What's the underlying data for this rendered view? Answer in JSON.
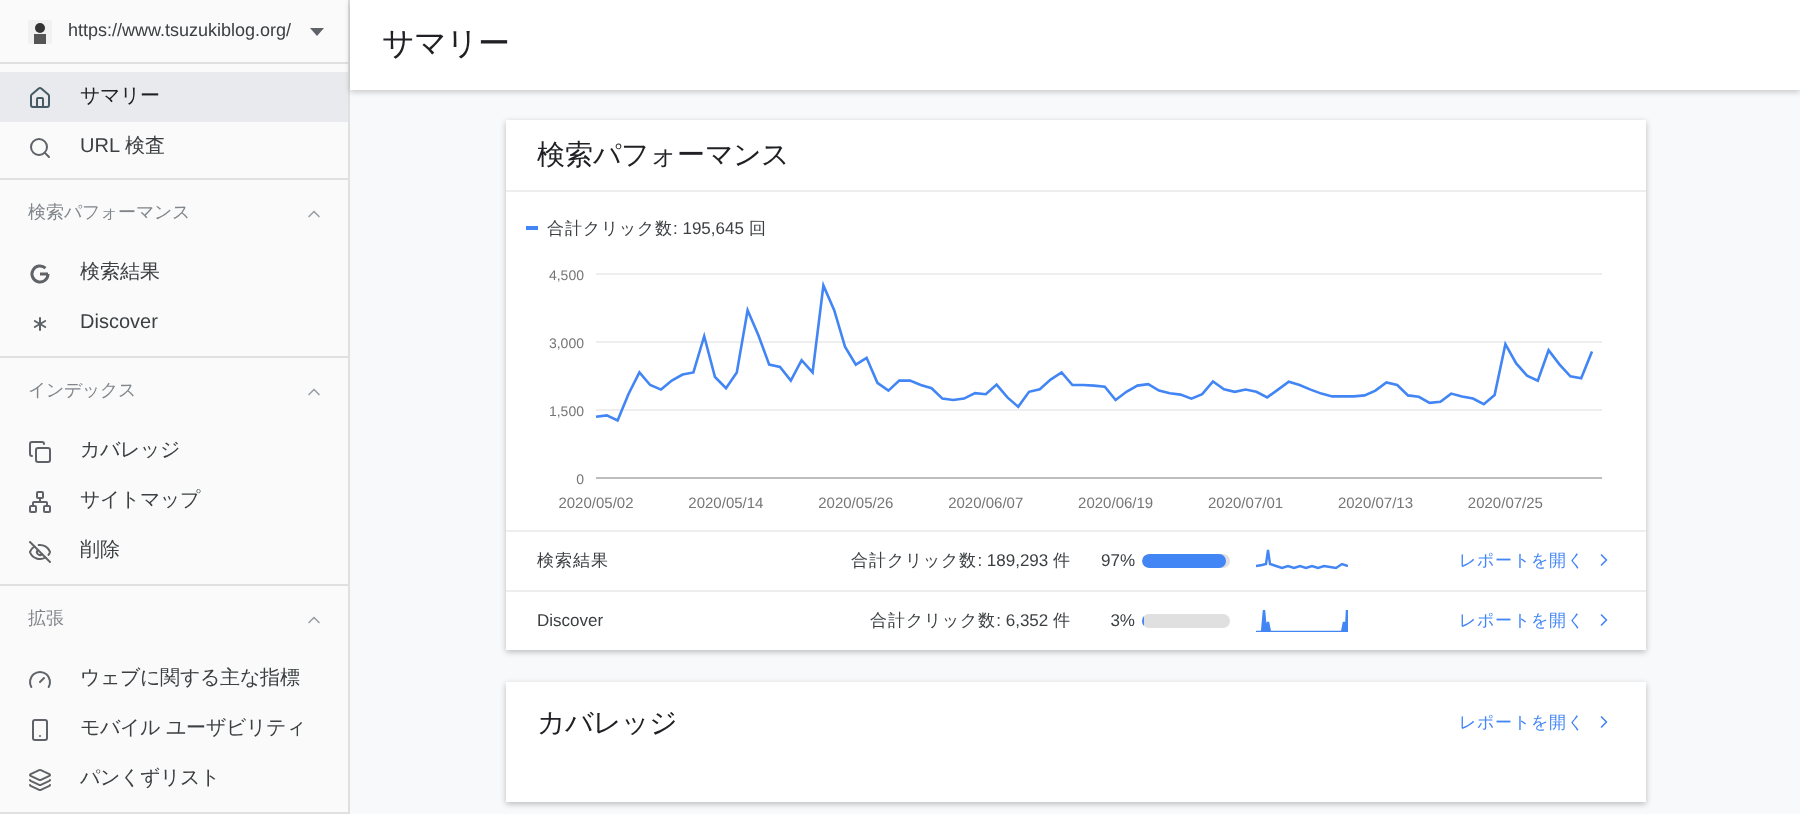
{
  "site": {
    "url": "https://www.tsuzukiblog.org/"
  },
  "page_title": "サマリー",
  "sidebar": {
    "items": [
      {
        "label": "サマリー",
        "selected": true
      },
      {
        "label": "URL 検査",
        "selected": false
      }
    ],
    "groups": [
      {
        "title": "検索パフォーマンス",
        "expanded": true,
        "items": [
          {
            "label": "検索結果",
            "selected": false
          },
          {
            "label": "Discover",
            "selected": false
          }
        ]
      },
      {
        "title": "インデックス",
        "expanded": true,
        "items": [
          {
            "label": "カバレッジ",
            "selected": false
          },
          {
            "label": "サイトマップ",
            "selected": false
          },
          {
            "label": "削除",
            "selected": false
          }
        ]
      },
      {
        "title": "拡張",
        "expanded": true,
        "items": [
          {
            "label": "ウェブに関する主な指標",
            "selected": false
          },
          {
            "label": "モバイル ユーザビリティ",
            "selected": false
          },
          {
            "label": "パンくずリスト",
            "selected": false
          }
        ]
      }
    ]
  },
  "performance": {
    "title": "検索パフォーマンス",
    "legend_value": ": 195,645 回",
    "chart_data": {
      "type": "line",
      "ylim": [
        0,
        4500
      ],
      "yticks": [
        {
          "value": 0,
          "label": "0"
        },
        {
          "value": 1500,
          "label": "1,500"
        },
        {
          "value": 3000,
          "label": "3,000"
        },
        {
          "value": 4500,
          "label": "4,500"
        }
      ],
      "categories": [
        "2020/05/02",
        null,
        null,
        null,
        null,
        null,
        null,
        null,
        null,
        null,
        null,
        null,
        "2020/05/14",
        null,
        null,
        null,
        null,
        null,
        null,
        null,
        null,
        null,
        null,
        null,
        "2020/05/26",
        null,
        null,
        null,
        null,
        null,
        null,
        null,
        null,
        null,
        null,
        null,
        "2020/06/07",
        null,
        null,
        null,
        null,
        null,
        null,
        null,
        null,
        null,
        null,
        null,
        "2020/06/19",
        null,
        null,
        null,
        null,
        null,
        null,
        null,
        null,
        null,
        null,
        null,
        "2020/07/01",
        null,
        null,
        null,
        null,
        null,
        null,
        null,
        null,
        null,
        null,
        null,
        "2020/07/13",
        null,
        null,
        null,
        null,
        null,
        null,
        null,
        null,
        null,
        null,
        null,
        "2020/07/25",
        null,
        null,
        null,
        null,
        null,
        null,
        null,
        null
      ],
      "series": [
        {
          "name": "合計クリック数",
          "color": "#4285f4",
          "values": [
            1350,
            1380,
            1270,
            1850,
            2330,
            2050,
            1950,
            2150,
            2280,
            2330,
            3130,
            2230,
            1980,
            2330,
            3700,
            3150,
            2500,
            2450,
            2150,
            2600,
            2330,
            4250,
            3700,
            2900,
            2500,
            2650,
            2100,
            1930,
            2150,
            2150,
            2050,
            1980,
            1750,
            1720,
            1750,
            1870,
            1850,
            2060,
            1780,
            1570,
            1900,
            1960,
            2170,
            2330,
            2050,
            2050,
            2040,
            2010,
            1720,
            1900,
            2040,
            2070,
            1930,
            1870,
            1840,
            1750,
            1850,
            2130,
            1960,
            1900,
            1950,
            1900,
            1780,
            1950,
            2120,
            2050,
            1950,
            1860,
            1800,
            1800,
            1800,
            1820,
            1930,
            2110,
            2050,
            1820,
            1790,
            1660,
            1680,
            1860,
            1800,
            1750,
            1630,
            1830,
            2950,
            2530,
            2260,
            2150,
            2820,
            2500,
            2240,
            2200,
            2790
          ]
        }
      ]
    },
    "rows": [
      {
        "label": "検索結果",
        "clicks": "合計クリック数: 189,293 件",
        "percent": "97%",
        "level": 0.97,
        "link": "レポートを開く"
      },
      {
        "label": "Discover",
        "clicks": "合計クリック数: 6,352 件",
        "percent": "3%",
        "level": 0.03,
        "link": "レポートを開く"
      }
    ]
  },
  "coverage": {
    "title": "カバレッジ",
    "link": "レポートを開く"
  }
}
